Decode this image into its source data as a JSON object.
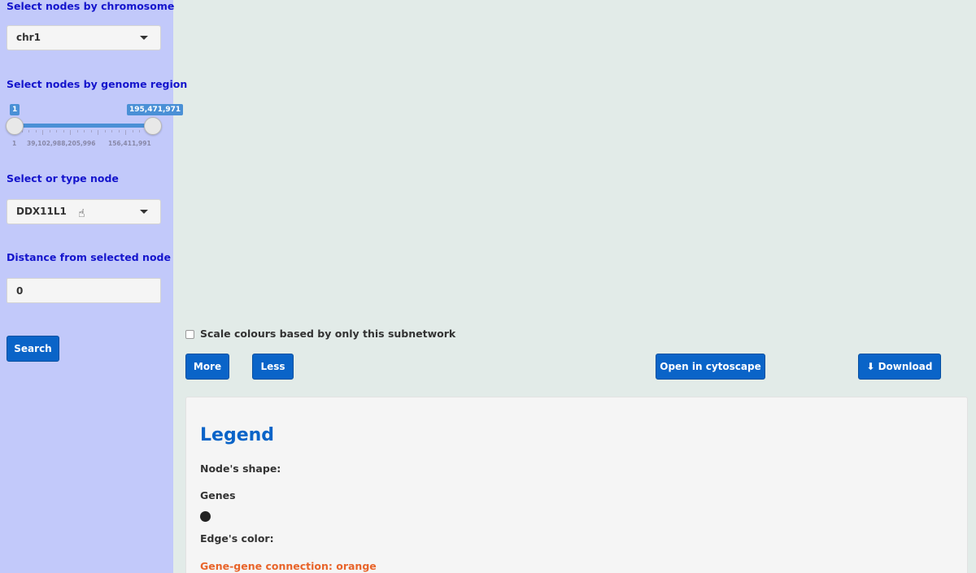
{
  "sidebar": {
    "chromosome_label": "Select nodes by chromosome",
    "chromosome_value": "chr1",
    "region_label": "Select nodes by genome region",
    "region_min_value": "1",
    "region_max_value": "195,471,971",
    "region_range": [
      1,
      195471971
    ],
    "region_selected": [
      1,
      195471971
    ],
    "tick_labels": [
      "1",
      "39,102,988,205,996",
      "156,411,991"
    ],
    "node_label": "Select or type node",
    "node_value": "DDX11L1",
    "distance_label": "Distance from selected node",
    "distance_value": "0",
    "search_label": "Search"
  },
  "main": {
    "scale_checkbox_label": "Scale colours based by only this subnetwork",
    "more_label": "More",
    "less_label": "Less",
    "cytoscape_label": "Open in cytoscape",
    "download_label": "Download"
  },
  "legend": {
    "title": "Legend",
    "shape_heading": "Node's shape:",
    "genes_label": "Genes",
    "edge_heading": "Edge's color:",
    "gene_gene_label": "Gene-gene connection: orange"
  },
  "colors": {
    "sidebar_bg": "#c2c9fa",
    "main_bg": "#e2ebe8",
    "accent": "#0a64c8",
    "label_blue": "#1414cc",
    "orange": "#e8642a"
  }
}
